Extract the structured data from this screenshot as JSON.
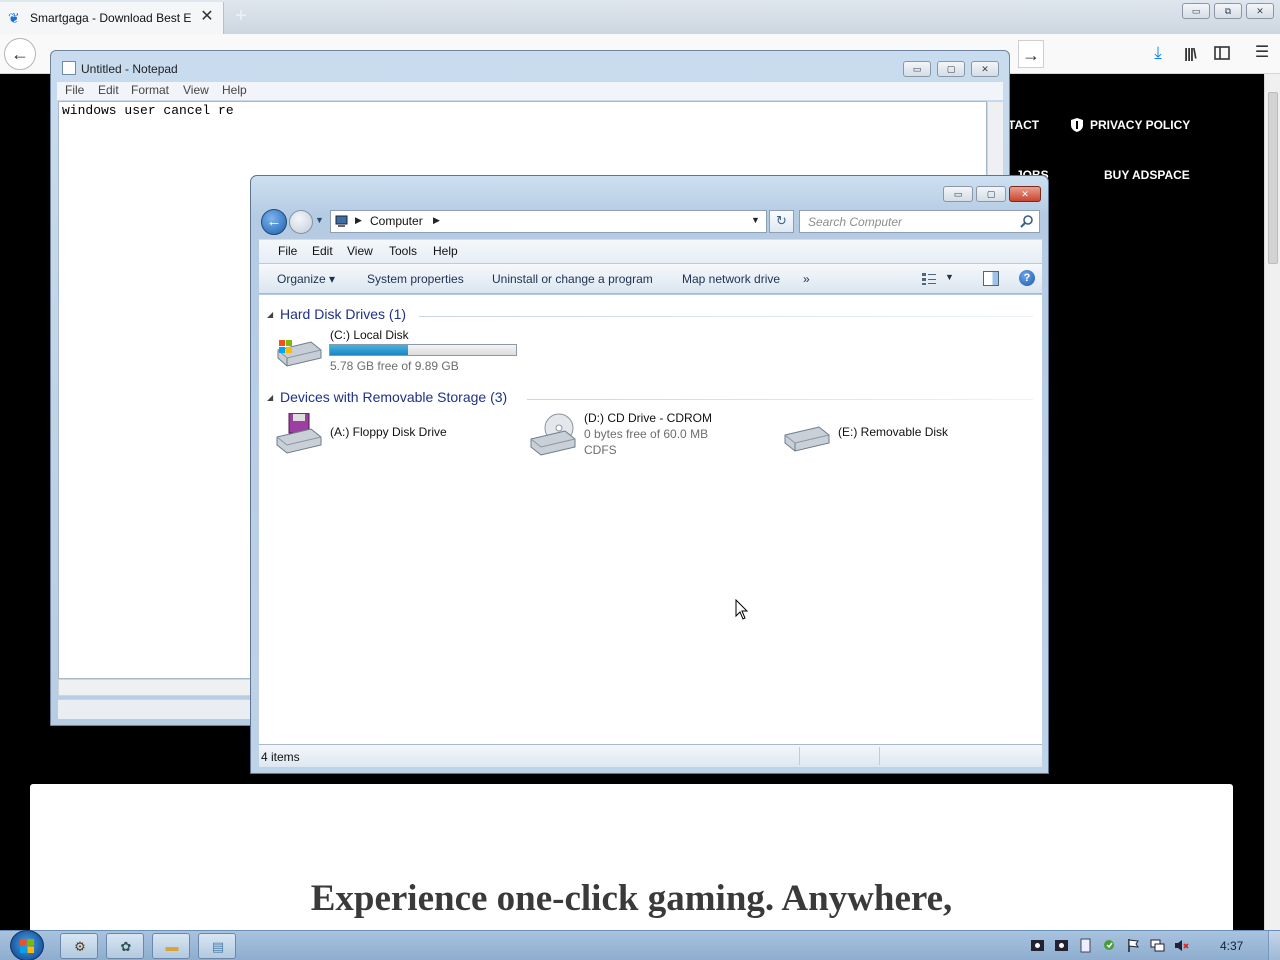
{
  "browser": {
    "tab_title": "Smartgaga - Download Best En",
    "tab_close": "✕",
    "new_tab": "+",
    "back_glyph": "←",
    "forward_glyph": "→",
    "download_glyph": "⤓",
    "library_glyph": "|||\\",
    "menu_glyph": "☰",
    "window_buttons": [
      "▭",
      "⧉",
      "✕"
    ]
  },
  "website": {
    "nav_contact": "TACT",
    "nav_privacy": "PRIVACY POLICY",
    "nav_jobs": "JOBS",
    "nav_buy": "BUY ADSPACE",
    "hero_text": "Experience one-click gaming. Anywhere,"
  },
  "notepad": {
    "title": "Untitled - Notepad",
    "menu": [
      "File",
      "Edit",
      "Format",
      "View",
      "Help"
    ],
    "text": "windows user cancel re",
    "window_buttons": [
      "▭",
      "▢",
      "✕"
    ]
  },
  "explorer": {
    "address_location": "Computer",
    "search_placeholder": "Search Computer",
    "menu": [
      "File",
      "Edit",
      "View",
      "Tools",
      "Help"
    ],
    "toolbar": {
      "organize": "Organize ▾",
      "system_properties": "System properties",
      "uninstall": "Uninstall or change a program",
      "map_drive": "Map network drive",
      "more": "»"
    },
    "groups": {
      "hard_disks": "Hard Disk Drives (1)",
      "removable": "Devices with Removable Storage (3)"
    },
    "drives": {
      "c": {
        "label": "(C:) Local Disk",
        "free": "5.78 GB free of 9.89 GB",
        "used_fraction": 0.42
      },
      "a": {
        "label": "(A:) Floppy Disk Drive"
      },
      "d": {
        "label": "(D:) CD Drive - CDROM",
        "free": "0 bytes free of 60.0 MB",
        "fs": "CDFS"
      },
      "e": {
        "label": "(E:) Removable Disk"
      }
    },
    "status": "4 items",
    "window_buttons": [
      "▭",
      "▢",
      "✕"
    ]
  },
  "taskbar": {
    "clock": "4:37"
  },
  "colors": {
    "accent": "#1c86c2",
    "close_red": "#c9452f",
    "taskbar": "#a8c3df"
  }
}
